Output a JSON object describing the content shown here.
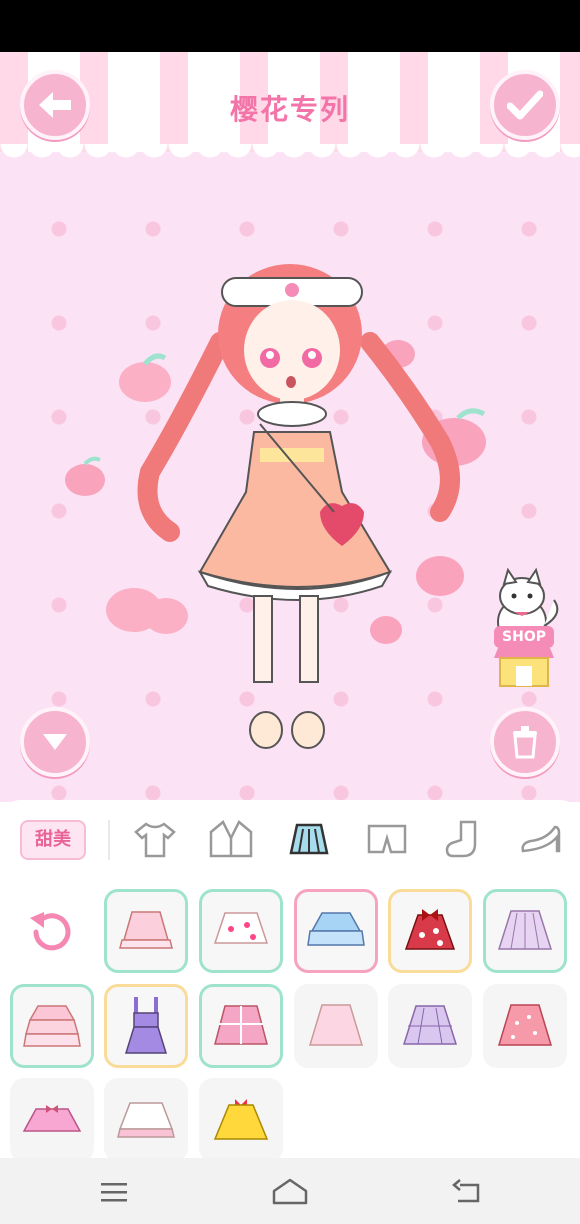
{
  "header": {
    "title": "樱花专列"
  },
  "side": {
    "shop_label": "SHOP"
  },
  "style_tag": "甜美",
  "categories": [
    "top-icon",
    "coat-icon",
    "skirt-icon",
    "shorts-icon",
    "sock-icon",
    "shoe-icon"
  ],
  "selected_category": "skirt-icon",
  "items": [
    {
      "name": "skirt-pink-ruffle",
      "border": "green"
    },
    {
      "name": "skirt-white-strawberry",
      "border": "green"
    },
    {
      "name": "skirt-blue-tiered",
      "border": "pink"
    },
    {
      "name": "skirt-red-polka-bow",
      "border": "yellow"
    },
    {
      "name": "skirt-lilac-pleated",
      "border": "green"
    },
    {
      "name": "skirt-pink-tiered",
      "border": "green"
    },
    {
      "name": "skirt-purple-overall",
      "border": "yellow"
    },
    {
      "name": "skirt-pink-plaid",
      "border": "green"
    },
    {
      "name": "skirt-light-pink",
      "border": "none"
    },
    {
      "name": "skirt-lavender-plaid",
      "border": "none"
    },
    {
      "name": "skirt-coral-dots",
      "border": "none"
    },
    {
      "name": "skirt-pink-bow-short",
      "border": "none"
    },
    {
      "name": "skirt-white-pink-lace",
      "border": "none"
    },
    {
      "name": "skirt-yellow-bow",
      "border": "none"
    }
  ],
  "colors": {
    "accent": "#f374a8",
    "background": "#fbe2f4",
    "button": "#f7b4cf"
  }
}
